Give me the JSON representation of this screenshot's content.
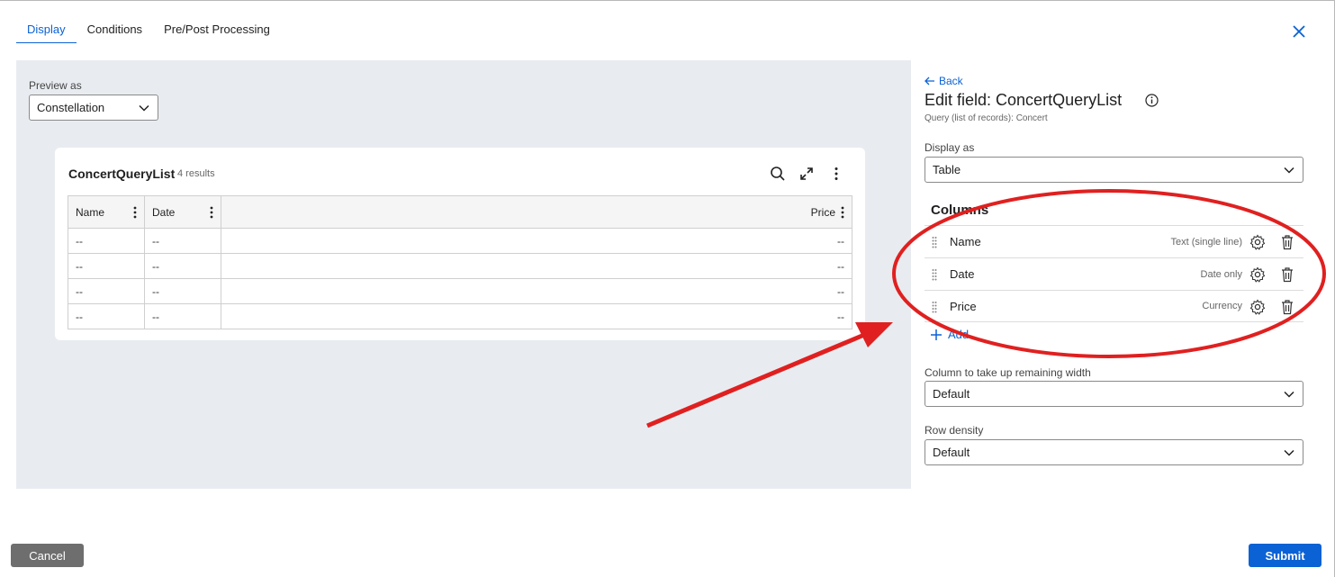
{
  "tabs": [
    {
      "label": "Display",
      "active": true
    },
    {
      "label": "Conditions",
      "active": false
    },
    {
      "label": "Pre/Post Processing",
      "active": false
    }
  ],
  "preview": {
    "label": "Preview as",
    "selected": "Constellation"
  },
  "card": {
    "title": "ConcertQueryList",
    "count": "4 results",
    "icons": [
      "search-icon",
      "expand-icon",
      "more-vertical-icon"
    ],
    "columns": [
      "Name",
      "Date",
      "Price"
    ],
    "rows": [
      [
        "--",
        "--",
        "--"
      ],
      [
        "--",
        "--",
        "--"
      ],
      [
        "--",
        "--",
        "--"
      ],
      [
        "--",
        "--",
        "--"
      ]
    ]
  },
  "panel": {
    "back_label": "Back",
    "title": "Edit field: ConcertQueryList",
    "subtitle": "Query (list of records): Concert",
    "display_as_label": "Display as",
    "display_as_value": "Table",
    "columns_title": "Columns",
    "columns": [
      {
        "name": "Name",
        "type": "Text (single line)"
      },
      {
        "name": "Date",
        "type": "Date only"
      },
      {
        "name": "Price",
        "type": "Currency"
      }
    ],
    "add_label": "Add",
    "remaining_width_label": "Column to take up remaining width",
    "remaining_width_value": "Default",
    "row_density_label": "Row density",
    "row_density_value": "Default"
  },
  "footer": {
    "cancel_label": "Cancel",
    "submit_label": "Submit"
  },
  "colors": {
    "accent": "#0b62d4",
    "preview_bg": "#e8ecf0",
    "annotation_red": "#e02020",
    "cancel_bg": "#6e6e6e"
  }
}
